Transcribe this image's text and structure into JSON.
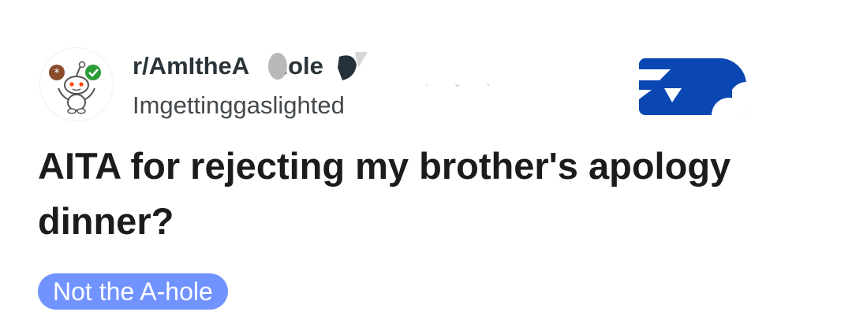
{
  "post": {
    "subreddit": "r/AmItheA",
    "subreddit_tail": "hole",
    "author": "Imgettinggaslighted",
    "title": "AITA for rejecting my brother's apology dinner?",
    "flair": "Not the A-hole"
  },
  "icons": {
    "avatar": "snoo-avatar-icon",
    "join": "join-icon",
    "obscured": "redaction-mark-icon"
  },
  "colors": {
    "flair_bg": "#7193ff",
    "join_bg": "#0b47b3",
    "title_text": "#1c1c1c",
    "author_text": "#44494d"
  }
}
